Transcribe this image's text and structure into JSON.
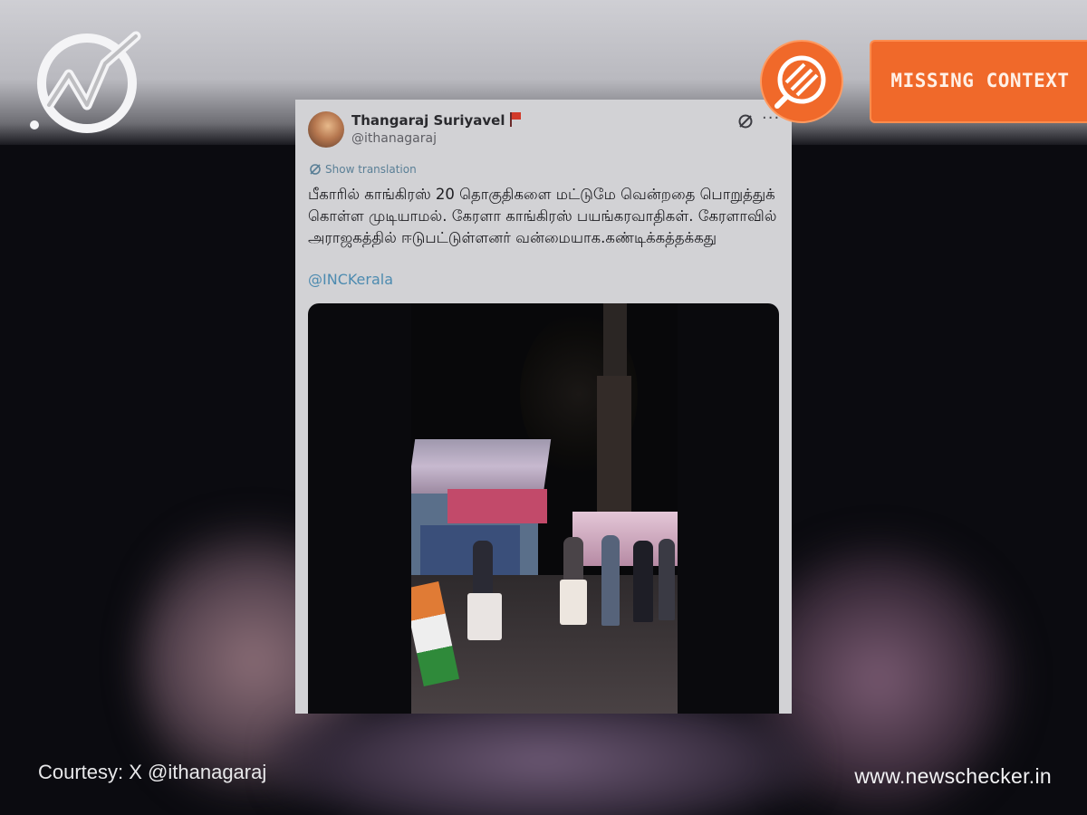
{
  "tweet": {
    "author_name": "Thangaraj Suriyavel",
    "author_handle": "@ithanagaraj",
    "translate_label": "Show translation",
    "text": "பீகாரில் காங்கிரஸ் 20 தொகுதிகளை மட்டுமே வென்றதை பொறுத்துக் கொள்ள முடியாமல். கேரளா காங்கிரஸ் பயங்கரவாதிகள். கேரளாவில் அராஜகத்தில் ஈடுபட்டுள்ளனர் வன்மையாக.கண்டிக்கத்தக்கது",
    "mention": "@INCKerala",
    "more_glyph": "···"
  },
  "rating": {
    "label": "MISSING CONTEXT",
    "color": "#f0692a"
  },
  "footer": {
    "courtesy": "Courtesy: X @ithanagaraj",
    "site": "www.newschecker.in"
  },
  "icons": [
    "newschecker-logo-icon",
    "flag-icon",
    "grok-icon",
    "more-options-icon",
    "translate-icon",
    "magnifier-badge-icon"
  ]
}
